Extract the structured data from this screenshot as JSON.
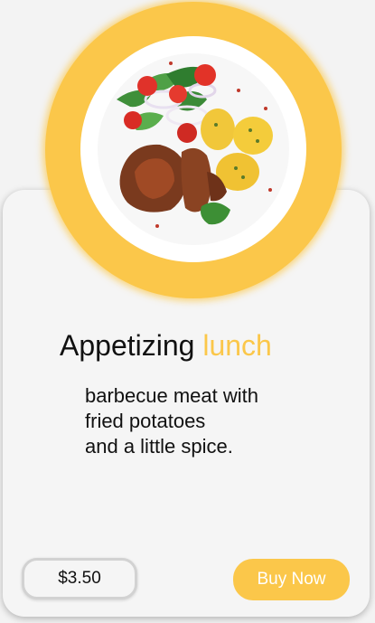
{
  "product": {
    "title_main": "Appetizing",
    "title_accent": "lunch",
    "description_lines": [
      "barbecue meat with",
      "fried potatoes",
      "and a little spice."
    ],
    "price": "$3.50",
    "buy_label": "Buy Now",
    "image_icon": "food-plate-image"
  },
  "colors": {
    "accent": "#fbc74a",
    "card": "#f5f5f5",
    "text": "#111111"
  }
}
